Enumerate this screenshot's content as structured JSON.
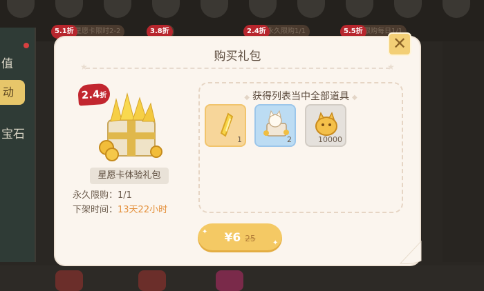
{
  "background": {
    "top_tags": [
      {
        "discount": "5.1折",
        "label": "星愿卡限时2-2"
      },
      {
        "discount": "3.8折",
        "label": ""
      },
      {
        "discount": "2.4折",
        "label": "永久限购1/1"
      },
      {
        "discount": "5.5折",
        "label": "限购每日1/1"
      }
    ],
    "left_menu": {
      "item_1": "值",
      "item_2": "动",
      "item_3": "宝石"
    }
  },
  "modal": {
    "title": "购买礼包",
    "close_label": "✕",
    "package": {
      "discount_number": "2.4",
      "discount_unit": "折",
      "name": "星愿卡体验礼包",
      "limit_label": "永久限购：",
      "limit_value": "1/1",
      "time_label": "下架时间：",
      "time_value": "13天22小时"
    },
    "rewards": {
      "title": "获得列表当中全部道具",
      "items": [
        {
          "icon": "wish-card-icon",
          "count": "1"
        },
        {
          "icon": "cat-box-icon",
          "count": "2"
        },
        {
          "icon": "coin-bag-icon",
          "count": "10000"
        }
      ]
    },
    "price": {
      "current": "¥6",
      "original": "25"
    }
  },
  "colors": {
    "modal_bg": "#fbf5ee",
    "accent_gold": "#f4c964",
    "discount_red": "#c2262f",
    "value_orange": "#e4913d"
  }
}
